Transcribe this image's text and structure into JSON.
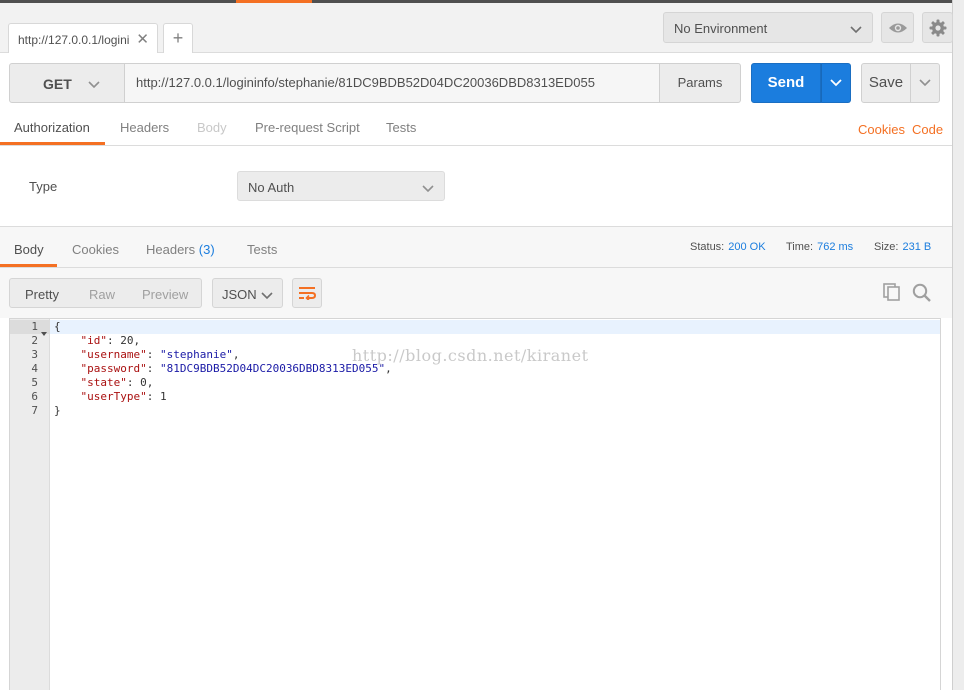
{
  "tab": {
    "label": "http://127.0.0.1/logini",
    "close": "✕",
    "new": "+"
  },
  "environment": {
    "label": "No Environment"
  },
  "request": {
    "method": "GET",
    "url": "http://127.0.0.1/logininfo/stephanie/81DC9BDB52D04DC20036DBD8313ED055",
    "params_label": "Params",
    "send_label": "Send",
    "save_label": "Save"
  },
  "request_tabs": [
    "Authorization",
    "Headers",
    "Body",
    "Pre-request Script",
    "Tests"
  ],
  "request_links": {
    "cookies": "Cookies",
    "code": "Code"
  },
  "auth": {
    "type_label": "Type",
    "value": "No Auth"
  },
  "response_tabs": {
    "body": "Body",
    "cookies": "Cookies",
    "headers": "Headers",
    "headers_count": "(3)",
    "tests": "Tests"
  },
  "metrics": {
    "status_label": "Status:",
    "status_value": "200 OK",
    "time_label": "Time:",
    "time_value": "762 ms",
    "size_label": "Size:",
    "size_value": "231 B"
  },
  "view_modes": {
    "pretty": "Pretty",
    "raw": "Raw",
    "preview": "Preview",
    "format": "JSON"
  },
  "code": {
    "line_numbers": [
      "1",
      "2",
      "3",
      "4",
      "5",
      "6",
      "7"
    ],
    "open": "{",
    "close": "}",
    "fields": [
      {
        "key": "\"id\"",
        "value": "20",
        "kind": "num",
        "comma": ","
      },
      {
        "key": "\"username\"",
        "value": "\"stephanie\"",
        "kind": "str",
        "comma": ","
      },
      {
        "key": "\"password\"",
        "value": "\"81DC9BDB52D04DC20036DBD8313ED055\"",
        "kind": "str",
        "comma": ","
      },
      {
        "key": "\"state\"",
        "value": "0",
        "kind": "num",
        "comma": ","
      },
      {
        "key": "\"userType\"",
        "value": "1",
        "kind": "num",
        "comma": ""
      }
    ]
  },
  "watermark": "http://blog.csdn.net/kiranet",
  "colors": {
    "accent": "#f47023",
    "primary": "#1b7dde",
    "string": "#1a1aa6",
    "key": "#aa1111"
  },
  "icons": [
    "close-icon",
    "plus-icon",
    "chevron-down-icon",
    "eye-icon",
    "gear-icon",
    "wrap-lines-icon",
    "copy-icon",
    "search-icon",
    "fold-arrow-icon"
  ]
}
